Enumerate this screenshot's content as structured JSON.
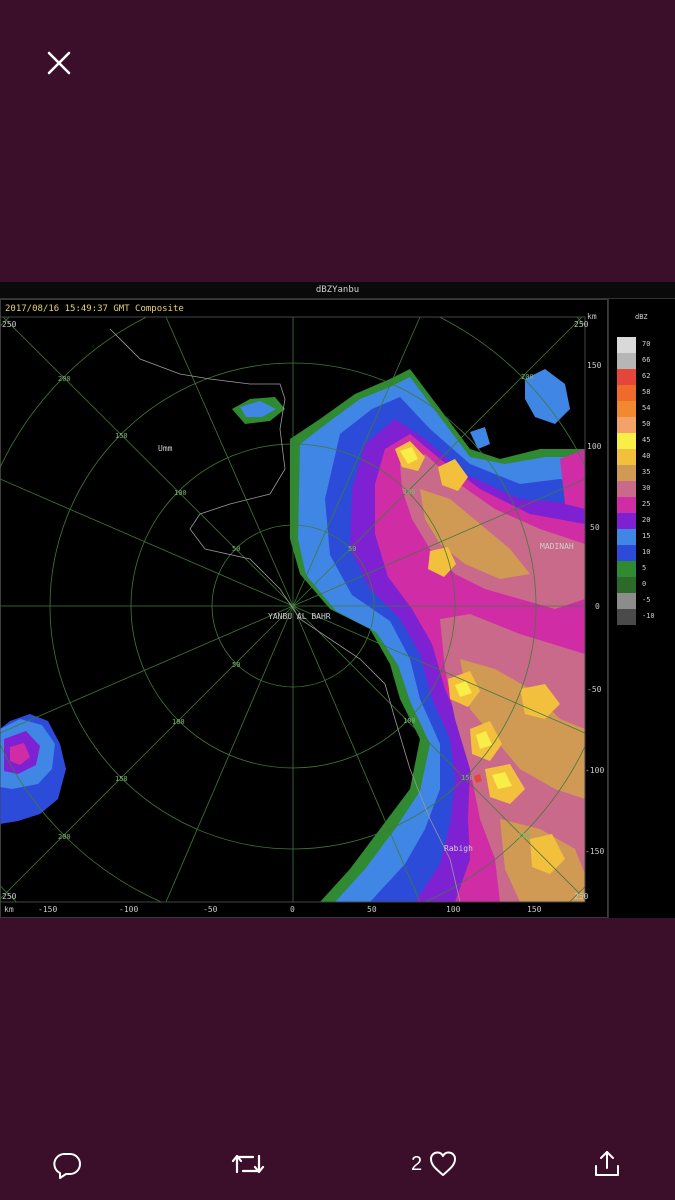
{
  "viewer": {
    "close_icon": "close-icon",
    "actions": {
      "reply_icon": "reply-icon",
      "retweet_icon": "retweet-icon",
      "like_icon": "heart-icon",
      "like_count": "2",
      "share_icon": "share-icon"
    }
  },
  "radar": {
    "title": "dBZYanbu",
    "timestamp": "2017/08/16 15:49:37 GMT Composite",
    "km_label_top": "km",
    "km_label_bottom": "km",
    "station_label": "YANBU AL BAHR",
    "places": [
      "Umm",
      "Rabigh",
      "MADINAH"
    ],
    "x_ticks": [
      "-150",
      "-100",
      "-50",
      "0",
      "50",
      "100",
      "150"
    ],
    "y_ticks": [
      "150",
      "100",
      "50",
      "0",
      "-50",
      "-100",
      "-150"
    ],
    "ring_labels": [
      "50",
      "100",
      "150",
      "200",
      "250"
    ],
    "corner_labels": [
      "250",
      "250",
      "250",
      "250"
    ],
    "legend_unit": "dBZ",
    "legend": [
      {
        "label": "70",
        "color": "#d9d9d9"
      },
      {
        "label": "66",
        "color": "#b6b6b6"
      },
      {
        "label": "62",
        "color": "#e6463a"
      },
      {
        "label": "58",
        "color": "#f06a2c"
      },
      {
        "label": "54",
        "color": "#f0892f"
      },
      {
        "label": "50",
        "color": "#f3a36a"
      },
      {
        "label": "45",
        "color": "#f9ee48"
      },
      {
        "label": "40",
        "color": "#f2c03c"
      },
      {
        "label": "35",
        "color": "#d09a55"
      },
      {
        "label": "30",
        "color": "#c96a8a"
      },
      {
        "label": "25",
        "color": "#d02ca6"
      },
      {
        "label": "20",
        "color": "#7d21d2"
      },
      {
        "label": "15",
        "color": "#3f86e5"
      },
      {
        "label": "10",
        "color": "#2c4bd8"
      },
      {
        "label": "5",
        "color": "#2f8a31"
      },
      {
        "label": "0",
        "color": "#2c6a2c"
      },
      {
        "label": "-5",
        "color": "#8c8c8c"
      },
      {
        "label": "-10",
        "color": "#4a4a4a"
      }
    ]
  }
}
